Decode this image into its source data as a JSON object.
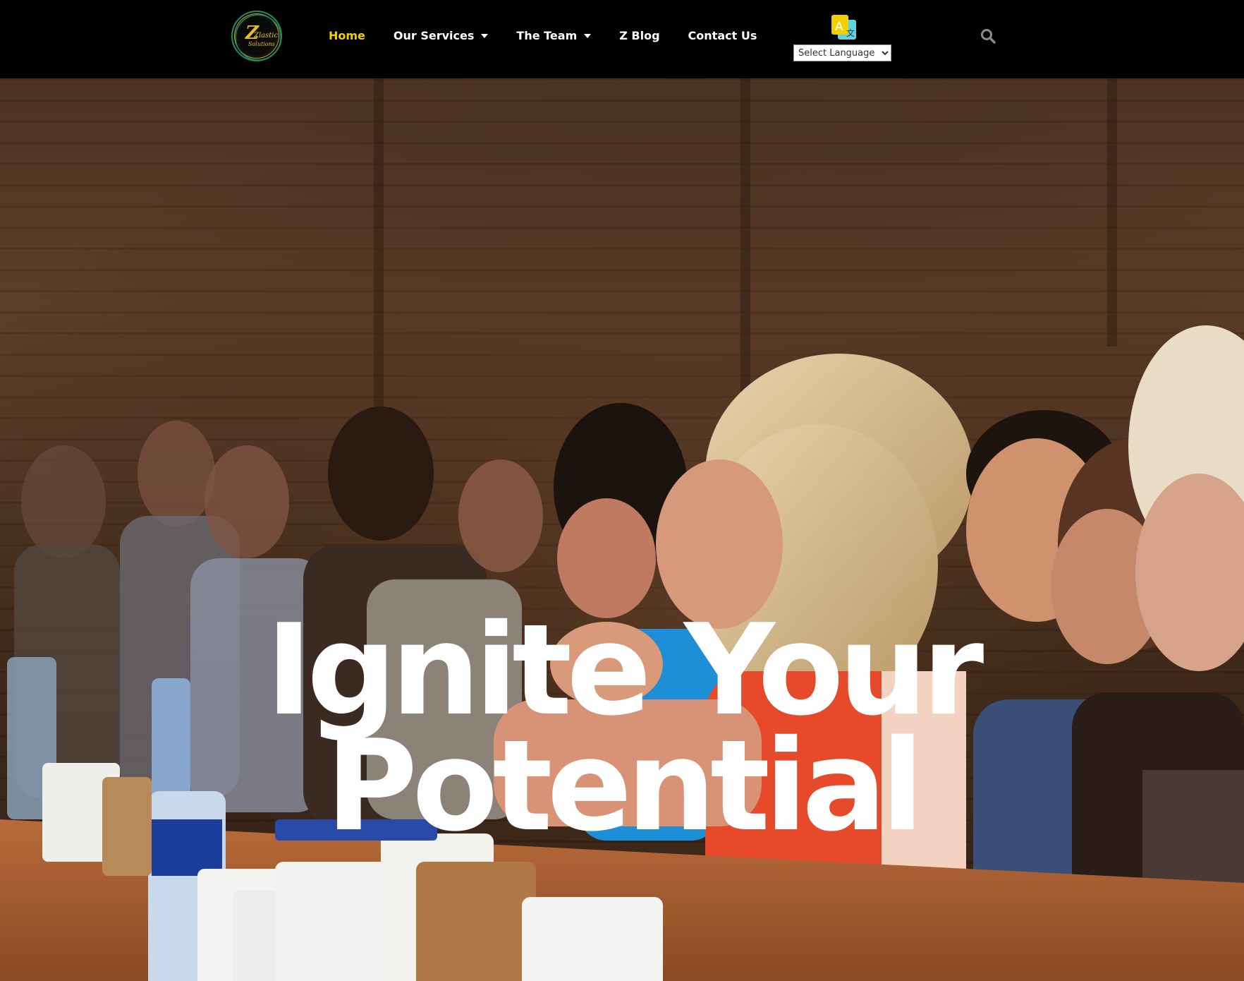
{
  "header": {
    "logo": {
      "icon": "zlastic-solutions-logo",
      "text_line1": "Zlastic",
      "text_line2": "Solutions"
    },
    "nav": [
      {
        "label": "Home",
        "active": true,
        "has_dropdown": false
      },
      {
        "label": "Our Services",
        "active": false,
        "has_dropdown": true
      },
      {
        "label": "The Team",
        "active": false,
        "has_dropdown": true
      },
      {
        "label": "Z Blog",
        "active": false,
        "has_dropdown": false
      },
      {
        "label": "Contact Us",
        "active": false,
        "has_dropdown": false
      }
    ],
    "translate_icon": "translate-icon",
    "language_select": {
      "selected": "Select Language"
    },
    "search_icon": "search-icon"
  },
  "hero": {
    "headline_line1": "Ignite Your",
    "headline_line2": "Potential",
    "background": "conference-audience-photo"
  },
  "colors": {
    "header_bg": "#000000",
    "nav_active": "#f2d000",
    "nav_text": "#ffffff",
    "headline": "#ffffff"
  }
}
